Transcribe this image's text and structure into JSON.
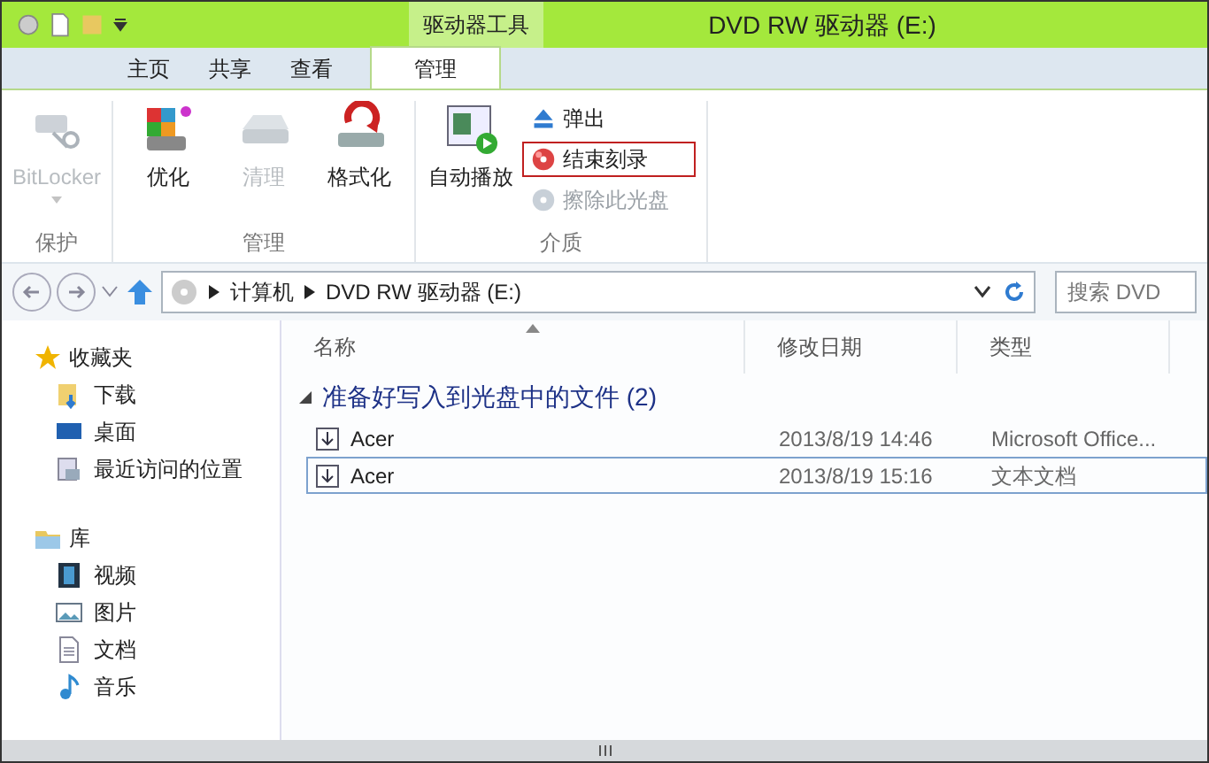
{
  "window": {
    "title": "DVD RW 驱动器 (E:)",
    "context_tab_group": "驱动器工具"
  },
  "tabs": [
    {
      "label": "主页",
      "selected": false
    },
    {
      "label": "共享",
      "selected": false
    },
    {
      "label": "查看",
      "selected": false
    },
    {
      "label": "管理",
      "selected": true
    }
  ],
  "ribbon": {
    "groups": [
      {
        "label": "保护",
        "items": [
          {
            "kind": "large",
            "label": "BitLocker",
            "disabled": true,
            "dropdown": true
          }
        ]
      },
      {
        "label": "管理",
        "items": [
          {
            "kind": "large",
            "label": "优化",
            "disabled": false
          },
          {
            "kind": "large",
            "label": "清理",
            "disabled": true
          },
          {
            "kind": "large",
            "label": "格式化",
            "disabled": false
          }
        ]
      },
      {
        "label": "介质",
        "items": [
          {
            "kind": "large",
            "label": "自动播放",
            "disabled": false
          },
          {
            "kind": "small",
            "label": "弹出",
            "disabled": false,
            "highlighted": false
          },
          {
            "kind": "small",
            "label": "结束刻录",
            "disabled": false,
            "highlighted": true
          },
          {
            "kind": "small",
            "label": "擦除此光盘",
            "disabled": true,
            "highlighted": false
          }
        ]
      }
    ]
  },
  "address": {
    "path": [
      "计算机",
      "DVD RW 驱动器 (E:)"
    ]
  },
  "search": {
    "placeholder": "搜索 DVD"
  },
  "sidebar": {
    "sections": [
      {
        "label": "收藏夹",
        "items": [
          {
            "label": "下载"
          },
          {
            "label": "桌面"
          },
          {
            "label": "最近访问的位置"
          }
        ]
      },
      {
        "label": "库",
        "items": [
          {
            "label": "视频"
          },
          {
            "label": "图片"
          },
          {
            "label": "文档"
          },
          {
            "label": "音乐"
          }
        ]
      }
    ]
  },
  "table": {
    "columns": [
      "名称",
      "修改日期",
      "类型"
    ],
    "group": {
      "label": "准备好写入到光盘中的文件 (2)",
      "expanded": true
    },
    "rows": [
      {
        "name": "Acer",
        "modified": "2013/8/19 14:46",
        "type": "Microsoft Office...",
        "focused": false
      },
      {
        "name": "Acer",
        "modified": "2013/8/19 15:16",
        "type": "文本文档",
        "focused": true
      }
    ]
  }
}
